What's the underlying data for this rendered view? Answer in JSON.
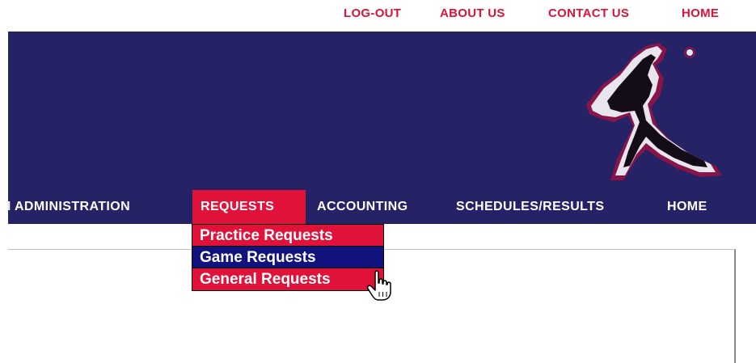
{
  "toplinks": {
    "logout": "LOG-OUT",
    "about": "ABOUT US",
    "contact": "CONTACT US",
    "home": "HOME"
  },
  "nav": {
    "items": [
      {
        "label": "M ADMINISTRATION"
      },
      {
        "label": "REQUESTS"
      },
      {
        "label": "ACCOUNTING"
      },
      {
        "label": "SCHEDULES/RESULTS"
      },
      {
        "label": "HOME"
      }
    ]
  },
  "dropdown": {
    "items": [
      {
        "label": "Practice Requests"
      },
      {
        "label": "Game Requests"
      },
      {
        "label": "General Requests"
      }
    ]
  },
  "colors": {
    "accent_red": "#e0123a",
    "banner_navy": "#262266",
    "hover_blue": "#12127e"
  },
  "icons": [
    "baseball-pitcher-logo",
    "hand-pointer-cursor-icon"
  ]
}
